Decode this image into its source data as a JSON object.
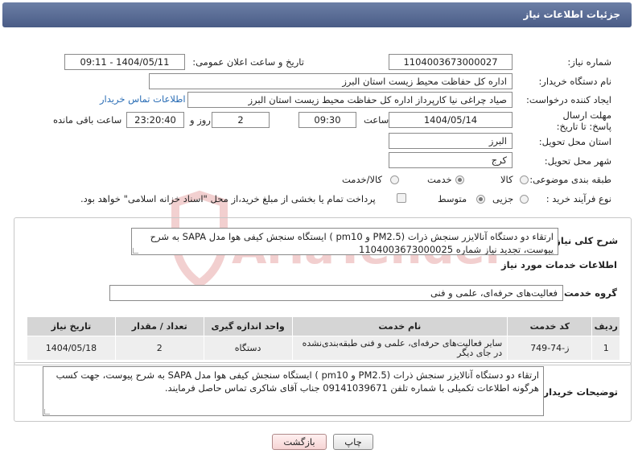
{
  "header": {
    "title": "جزئیات اطلاعات نیاز"
  },
  "form": {
    "need_number_label": "شماره نیاز:",
    "need_number": "1104003673000027",
    "announce_label": "تاریخ و ساعت اعلان عمومی:",
    "announce_value": "1404/05/11 - 09:11",
    "buyer_org_label": "نام دستگاه خریدار:",
    "buyer_org": "اداره کل حفاظت محیط زیست استان البرز",
    "creator_label": "ایجاد کننده درخواست:",
    "creator": "صیاد چراغی نیا کارپرداز اداره کل حفاظت محیط زیست استان البرز",
    "contact_link": "اطلاعات تماس خریدار",
    "deadline_label": "مهلت ارسال پاسخ: تا تاریخ:",
    "deadline_date": "1404/05/14",
    "time_label": "ساعت",
    "deadline_time": "09:30",
    "days_value": "2",
    "days_label": "روز و",
    "remaining_value": "23:20:40",
    "remaining_label": "ساعت باقی مانده",
    "province_label": "استان محل تحویل:",
    "province": "البرز",
    "city_label": "شهر محل تحویل:",
    "city": "کرج",
    "category_label": "طبقه بندی موضوعی:",
    "category_options": [
      "کالا",
      "خدمت",
      "کالا/خدمت"
    ],
    "category_selected": "خدمت",
    "process_label": "نوع فرآیند خرید :",
    "process_options": [
      "جزیی",
      "متوسط"
    ],
    "process_selected": "متوسط",
    "payment_note": "پرداخت تمام یا بخشی از مبلغ خرید،از محل \"اسناد خزانه اسلامی\" خواهد بود."
  },
  "summary": {
    "label": "شرح کلی نیاز:",
    "text": "ارتقاء دو دستگاه آنالایزر سنجش ذرات (PM2.5  و pm10 ) ایستگاه سنجش کیفی هوا مدل SAPA به شرح پیوست، تجدید نیاز شماره 1104003673000025"
  },
  "services": {
    "section_title": "اطلاعات خدمات مورد نیاز",
    "group_label": "گروه خدمت:",
    "group_value": "فعالیت‌های حرفه‌ای، علمی و فنی",
    "columns": [
      "ردیف",
      "کد خدمت",
      "نام خدمت",
      "واحد اندازه گیری",
      "تعداد / مقدار",
      "تاریخ نیاز"
    ],
    "rows": [
      {
        "index": "1",
        "code": "ز-74-749",
        "name": "سایر فعالیت‌های حرفه‌ای، علمی و فنی طبقه‌بندی‌نشده در جای دیگر",
        "unit": "دستگاه",
        "qty": "2",
        "date": "1404/05/18"
      }
    ]
  },
  "buyer_notes": {
    "label": "توضیحات خریدار:",
    "text": "ارتقاء دو دستگاه آنالایزر سنجش ذرات (PM2.5  و pm10 ) ایستگاه سنجش کیفی هوا مدل SAPA  به شرح پیوست، جهت کسب هرگونه اطلاعات تکمیلی با شماره تلفن 09141039671 جناب آقای شاکری تماس حاصل فرمایند."
  },
  "buttons": {
    "print": "چاپ",
    "back": "بازگشت"
  },
  "watermark": {
    "text": "AriaTender.neT"
  },
  "colors": {
    "header": "#5a6d96",
    "link": "#2a6db5",
    "watermark": "#e8a9a9"
  }
}
